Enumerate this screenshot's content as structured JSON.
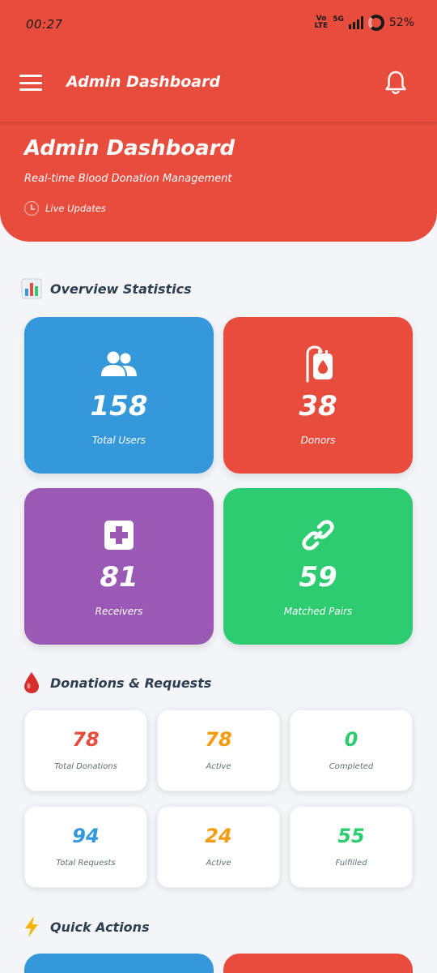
{
  "status_bar": {
    "time": "00:27",
    "network": "Vo LTE",
    "signal_label": "5G",
    "battery": "52%"
  },
  "app_bar": {
    "title": "Admin Dashboard",
    "menu_icon": "hamburger-menu-icon",
    "notification_icon": "bell-icon"
  },
  "hero": {
    "title": "Admin Dashboard",
    "subtitle": "Real-time Blood Donation Management",
    "live_label": "Live Updates"
  },
  "overview": {
    "heading": "Overview Statistics",
    "icon": "bar-chart-icon",
    "cards": [
      {
        "value": "158",
        "label": "Total Users",
        "color": "#3498db",
        "icon": "users-icon"
      },
      {
        "value": "38",
        "label": "Donors",
        "color": "#e84c3d",
        "icon": "blood-bag-icon"
      },
      {
        "value": "81",
        "label": "Receivers",
        "color": "#9b59b6",
        "icon": "medical-cross-icon"
      },
      {
        "value": "59",
        "label": "Matched Pairs",
        "color": "#2ecc71",
        "icon": "link-icon"
      }
    ]
  },
  "donations": {
    "heading": "Donations & Requests",
    "icon": "blood-drop-icon",
    "cards": [
      {
        "value": "78",
        "label": "Total Donations",
        "color": "#e84c3d"
      },
      {
        "value": "78",
        "label": "Active",
        "color": "#f39c12"
      },
      {
        "value": "0",
        "label": "Completed",
        "color": "#2ecc71"
      },
      {
        "value": "94",
        "label": "Total Requests",
        "color": "#3498db"
      },
      {
        "value": "24",
        "label": "Active",
        "color": "#f39c12"
      },
      {
        "value": "55",
        "label": "Fulfilled",
        "color": "#2ecc71"
      }
    ]
  },
  "quick_actions": {
    "heading": "Quick Actions",
    "icon": "lightning-icon",
    "colors": [
      "#3498db",
      "#e84c3d"
    ]
  }
}
